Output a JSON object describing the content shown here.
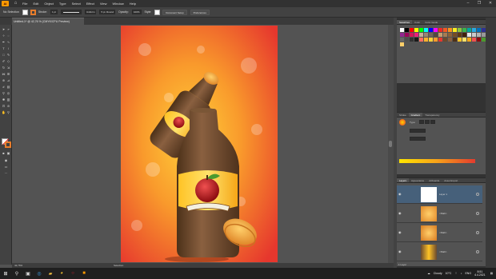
{
  "menubar": {
    "app_logo": "Ai",
    "items": [
      "File",
      "Edit",
      "Object",
      "Type",
      "Select",
      "Effect",
      "View",
      "Window",
      "Help"
    ]
  },
  "control": {
    "selection_state": "No Selection",
    "stroke_label": "Stroke:",
    "stroke_weight": "1 pt",
    "stroke_profile": "Uniform",
    "brush": "5 pt. Round",
    "opacity_label": "Opacity:",
    "opacity_value": "100%",
    "style_label": "Style:",
    "document_setup": "Document Setup",
    "preferences": "Preferences"
  },
  "document": {
    "tab_title": "Untitled-1* @ 42,76 % (CMYK/CPU Preview)",
    "zoom": "42,76%",
    "tool_status": "Selection"
  },
  "panels": {
    "swatches_tabs": [
      "Swatches",
      "Color",
      "Color Guide"
    ],
    "gradient_tabs": [
      "Stroke",
      "Gradient",
      "Transparency"
    ],
    "gradient_type_label": "Type:",
    "layers_tabs": [
      "Layers",
      "Appearance",
      "Artboards",
      "Asset Export"
    ],
    "layers": [
      {
        "name": "Layer 1"
      },
      {
        "name": "<Path>"
      },
      {
        "name": "<Path>"
      },
      {
        "name": "<Path>"
      }
    ],
    "layers_count": "1 Layer"
  },
  "taskbar": {
    "weather": "Cloudy",
    "temperature": "10°C",
    "language": "ENG",
    "time": "8:51",
    "date": "4.4.2021"
  },
  "colors": {
    "menubar_bg": "#323232",
    "panel_bg": "#535353",
    "accent_orange": "#ff9a00",
    "artboard_red": "#e63b2e",
    "artboard_yellow": "#ffb22e",
    "bottle_brown": "#6b4a2e"
  },
  "icons": [
    "home-icon",
    "selection-tool-icon",
    "pen-tool-icon",
    "type-tool-icon",
    "eye-icon",
    "windows-start-icon",
    "search-icon"
  ]
}
